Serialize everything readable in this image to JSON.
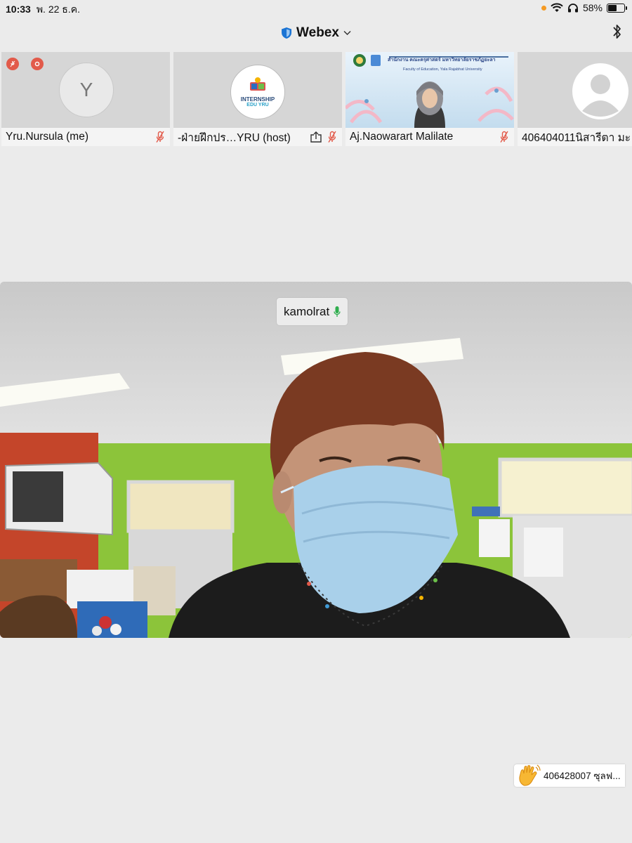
{
  "status_bar": {
    "time": "10:33",
    "date": "พ. 22 ธ.ค.",
    "battery": "58%",
    "battery_level": 0.58
  },
  "app": {
    "title": "Webex"
  },
  "participants": [
    {
      "name": "Yru.Nursula (me)",
      "avatar_letter": "Y",
      "muted": true
    },
    {
      "name": "-ฝ่ายฝึกปร…YRU (host)",
      "logo_line1": "INTERNSHIP",
      "logo_line2": "EDU YRU",
      "muted": true,
      "sharing": true
    },
    {
      "name": "Aj.Naowarart Malilate",
      "banner_th": "สำนักงาน คณะครุศาสตร์ มหาวิทยาลัยราชภัฏยะลา",
      "banner_en": "Faculty of Education, Yala Rajabhat University",
      "muted": true
    },
    {
      "name": "406404011นิสารีตา มะ"
    }
  ],
  "active_speaker": {
    "name": "kamolrat"
  },
  "raised_hand": {
    "name": "406428007 ซุลฟ..."
  },
  "colors": {
    "background": "#ebebeb",
    "muted_icon": "#e25a4a",
    "mic_active": "#2fae4e",
    "webex_shield": "#1b74d4"
  }
}
